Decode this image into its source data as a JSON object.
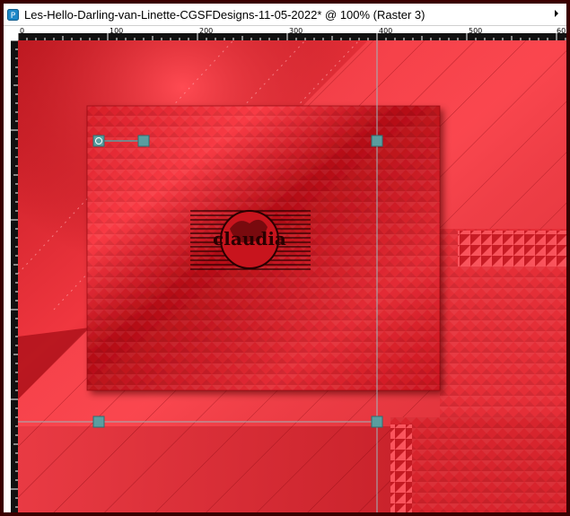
{
  "window": {
    "title": "Les-Hello-Darling-van-Linette-CGSFDesigns-11-05-2022* @ 100% (Raster 3)",
    "app_icon": "paint-shop-pro-icon",
    "control_icon": "scroll-arrow-icon"
  },
  "ruler": {
    "unit": "px",
    "labels": [
      "0",
      "100",
      "200",
      "300",
      "400",
      "500",
      "60"
    ]
  },
  "canvas": {
    "watermark_text": "claudia",
    "colors": {
      "base": "#d4232c",
      "dark": "#9e0a12",
      "light": "#f5464f",
      "guide": "#9fb6bb",
      "handle": "#5a9ea0"
    }
  }
}
